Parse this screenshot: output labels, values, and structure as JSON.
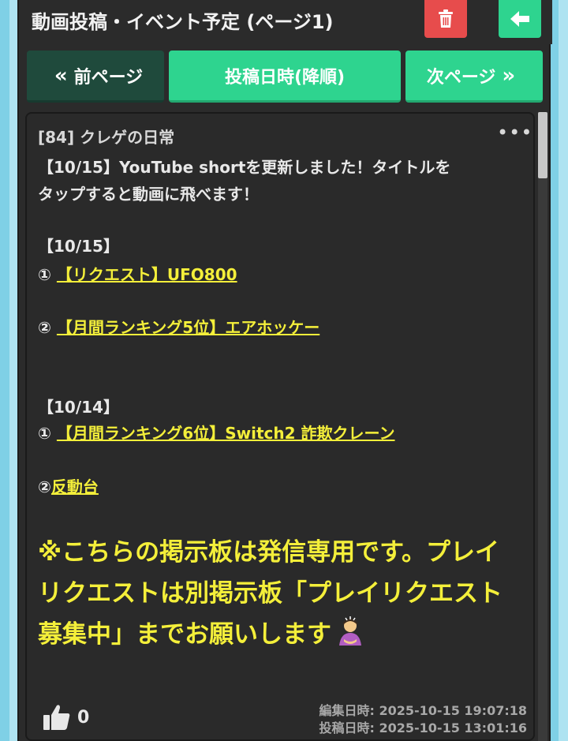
{
  "header": {
    "title": "動画投稿・イベント予定 (ページ1)",
    "delete_icon": "trash-icon",
    "back_icon": "arrow-left-icon"
  },
  "nav": {
    "prev_label": "前ページ",
    "sort_label": "投稿日時(降順)",
    "next_label": "次ページ"
  },
  "post": {
    "title": "[84] クレゲの日常",
    "more_icon": "more-dots-icon",
    "intro_line1": "【10/15】YouTube shortを更新しました！タイトルを",
    "intro_line2": "タップすると動画に飛べます！",
    "date1": "【10/15】",
    "item1_num": "①",
    "item1_link": "【リクエスト】UFO800",
    "item2_num": "②",
    "item2_link": "【月間ランキング5位】エアホッケー",
    "date2": "【10/14】",
    "item3_num": "①",
    "item3_link": "【月間ランキング6位】Switch2 詐欺クレーン",
    "item4_num": "②",
    "item4_link": "反動台",
    "notice": "※こちらの掲示板は発信専用です。プレイリクエストは別掲示板「プレイリクエスト募集中」までお願いします",
    "like_count": "0",
    "edited": "編集日時: 2025-10-15 19:07:18",
    "posted": "投稿日時: 2025-10-15 13:01:16"
  },
  "colors": {
    "accent_green": "#2ed48f",
    "dark_green": "#1f4a3c",
    "danger_red": "#e74c4c",
    "link_yellow": "#f4ef3a"
  }
}
